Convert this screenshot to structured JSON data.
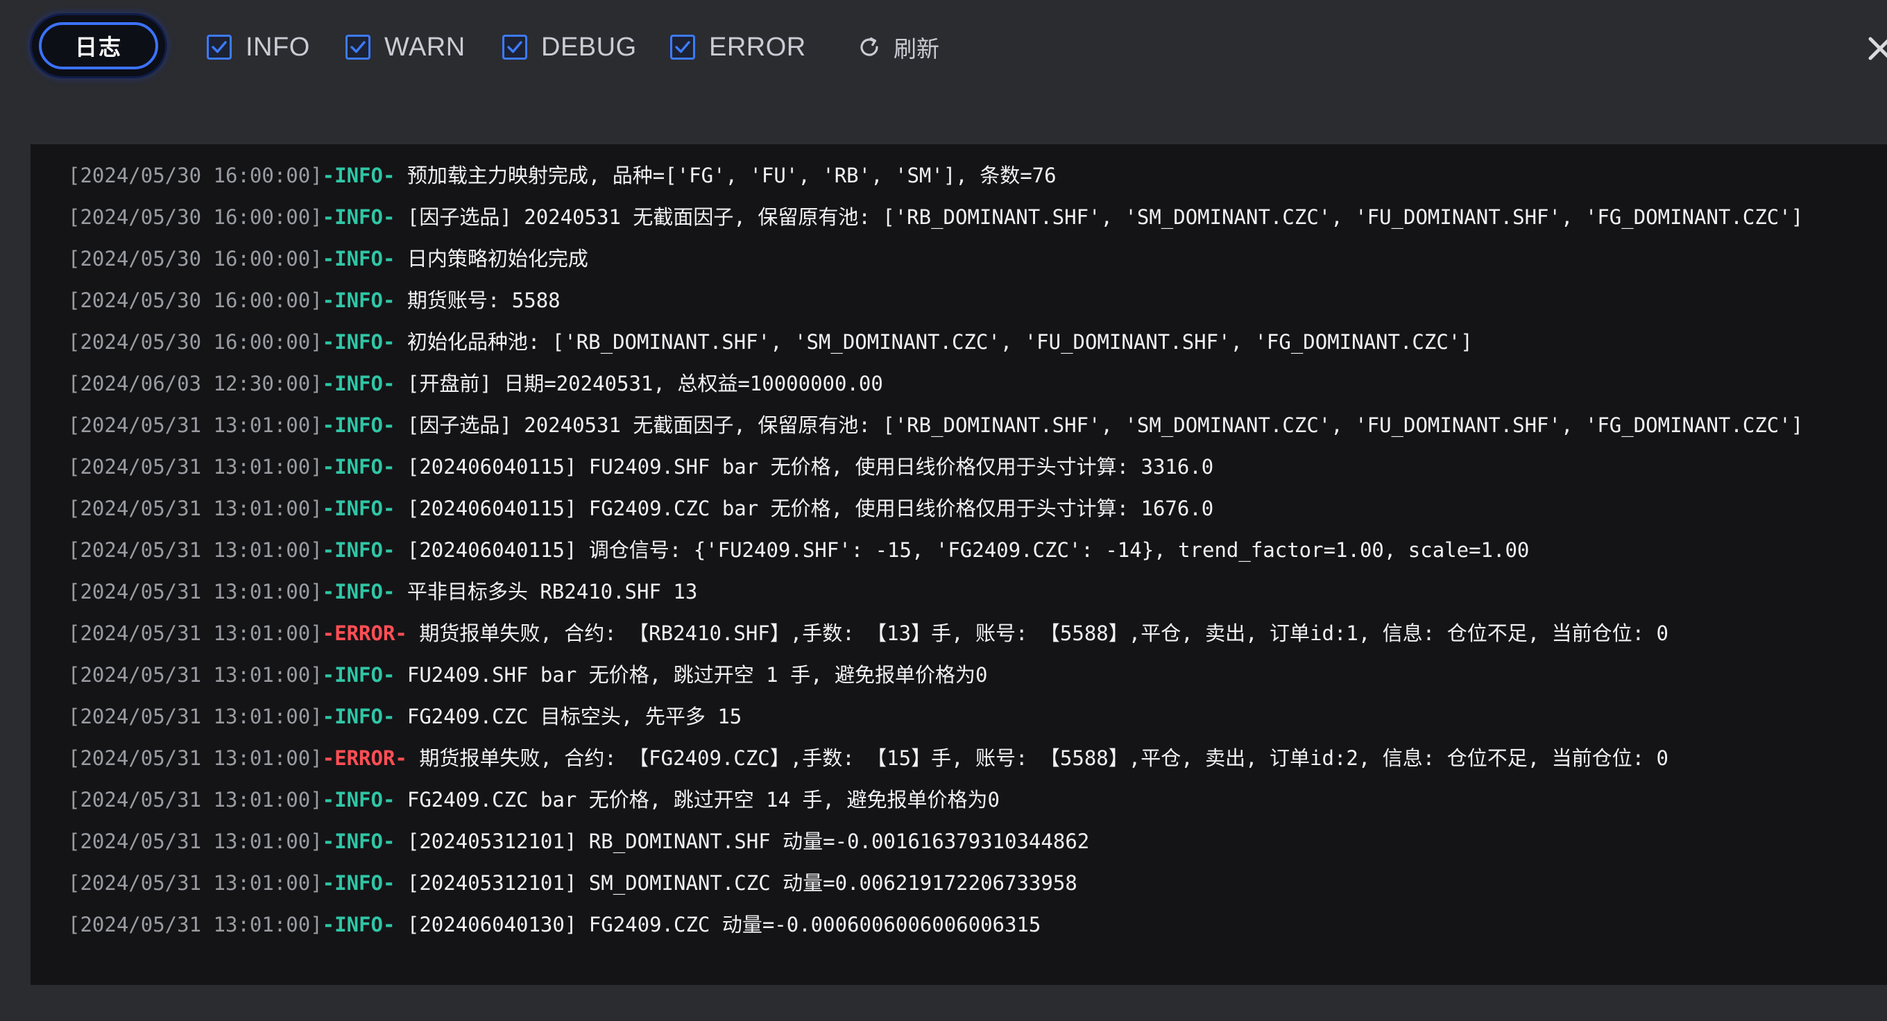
{
  "toolbar": {
    "tab_label": "日志",
    "filters": [
      {
        "label": "INFO",
        "checked": true
      },
      {
        "label": "WARN",
        "checked": true
      },
      {
        "label": "DEBUG",
        "checked": true
      },
      {
        "label": "ERROR",
        "checked": true
      }
    ],
    "refresh_label": "刷新",
    "refresh_icon": "refresh-icon",
    "close_icon": "close-icon",
    "accent_color": "#3b72ff"
  },
  "colors": {
    "info": "#2fc6a6",
    "error": "#ff4f55",
    "timestamp": "#9a9ca3"
  },
  "log": {
    "lines": [
      {
        "ts": "[2024/05/30 16:00:00]",
        "level": "-INFO-",
        "msg": " 预加载主力映射完成, 品种=['FG', 'FU', 'RB', 'SM'], 条数=76"
      },
      {
        "ts": "[2024/05/30 16:00:00]",
        "level": "-INFO-",
        "msg": " [因子选品] 20240531 无截面因子, 保留原有池: ['RB_DOMINANT.SHF', 'SM_DOMINANT.CZC', 'FU_DOMINANT.SHF', 'FG_DOMINANT.CZC']"
      },
      {
        "ts": "[2024/05/30 16:00:00]",
        "level": "-INFO-",
        "msg": " 日内策略初始化完成"
      },
      {
        "ts": "[2024/05/30 16:00:00]",
        "level": "-INFO-",
        "msg": " 期货账号: 5588"
      },
      {
        "ts": "[2024/05/30 16:00:00]",
        "level": "-INFO-",
        "msg": " 初始化品种池: ['RB_DOMINANT.SHF', 'SM_DOMINANT.CZC', 'FU_DOMINANT.SHF', 'FG_DOMINANT.CZC']"
      },
      {
        "ts": "[2024/06/03 12:30:00]",
        "level": "-INFO-",
        "msg": " [开盘前] 日期=20240531, 总权益=10000000.00"
      },
      {
        "ts": "[2024/05/31 13:01:00]",
        "level": "-INFO-",
        "msg": " [因子选品] 20240531 无截面因子, 保留原有池: ['RB_DOMINANT.SHF', 'SM_DOMINANT.CZC', 'FU_DOMINANT.SHF', 'FG_DOMINANT.CZC']"
      },
      {
        "ts": "[2024/05/31 13:01:00]",
        "level": "-INFO-",
        "msg": " [202406040115] FU2409.SHF bar 无价格, 使用日线价格仅用于头寸计算: 3316.0"
      },
      {
        "ts": "[2024/05/31 13:01:00]",
        "level": "-INFO-",
        "msg": " [202406040115] FG2409.CZC bar 无价格, 使用日线价格仅用于头寸计算: 1676.0"
      },
      {
        "ts": "[2024/05/31 13:01:00]",
        "level": "-INFO-",
        "msg": " [202406040115] 调仓信号: {'FU2409.SHF': -15, 'FG2409.CZC': -14}, trend_factor=1.00, scale=1.00"
      },
      {
        "ts": "[2024/05/31 13:01:00]",
        "level": "-INFO-",
        "msg": " 平非目标多头 RB2410.SHF 13"
      },
      {
        "ts": "[2024/05/31 13:01:00]",
        "level": "-ERROR-",
        "msg": " 期货报单失败, 合约: 【RB2410.SHF】,手数: 【13】手, 账号: 【5588】,平仓, 卖出, 订单id:1, 信息: 仓位不足, 当前仓位: 0"
      },
      {
        "ts": "[2024/05/31 13:01:00]",
        "level": "-INFO-",
        "msg": " FU2409.SHF bar 无价格, 跳过开空 1 手, 避免报单价格为0"
      },
      {
        "ts": "[2024/05/31 13:01:00]",
        "level": "-INFO-",
        "msg": " FG2409.CZC 目标空头, 先平多 15"
      },
      {
        "ts": "[2024/05/31 13:01:00]",
        "level": "-ERROR-",
        "msg": " 期货报单失败, 合约: 【FG2409.CZC】,手数: 【15】手, 账号: 【5588】,平仓, 卖出, 订单id:2, 信息: 仓位不足, 当前仓位: 0"
      },
      {
        "ts": "[2024/05/31 13:01:00]",
        "level": "-INFO-",
        "msg": " FG2409.CZC bar 无价格, 跳过开空 14 手, 避免报单价格为0"
      },
      {
        "ts": "[2024/05/31 13:01:00]",
        "level": "-INFO-",
        "msg": " [202405312101] RB_DOMINANT.SHF 动量=-0.001616379310344862"
      },
      {
        "ts": "[2024/05/31 13:01:00]",
        "level": "-INFO-",
        "msg": " [202405312101] SM_DOMINANT.CZC 动量=0.006219172206733958"
      },
      {
        "ts": "[2024/05/31 13:01:00]",
        "level": "-INFO-",
        "msg": " [202406040130] FG2409.CZC 动量=-0.0006006006006006315"
      }
    ]
  }
}
